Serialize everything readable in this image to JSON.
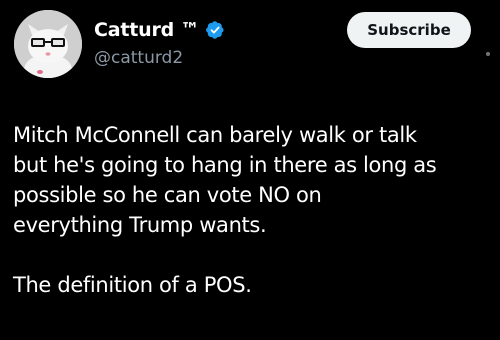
{
  "author": {
    "display_name": "Catturd ™",
    "handle": "@catturd2",
    "verified_icon": "verified-badge-icon",
    "avatar_icon": "cat-with-glasses-avatar"
  },
  "actions": {
    "subscribe_label": "Subscribe"
  },
  "tweet": {
    "lines": [
      "Mitch McConnell can barely walk or talk",
      "but he's going to hang in there as long as",
      "possible so he can vote NO on",
      "everything Trump wants."
    ],
    "closing": "The definition of a POS."
  },
  "colors": {
    "background": "#000000",
    "text": "#ffffff",
    "secondary_text": "#8b98a5",
    "verified_blue": "#1d9bf0",
    "button_bg": "#eff3f4"
  }
}
